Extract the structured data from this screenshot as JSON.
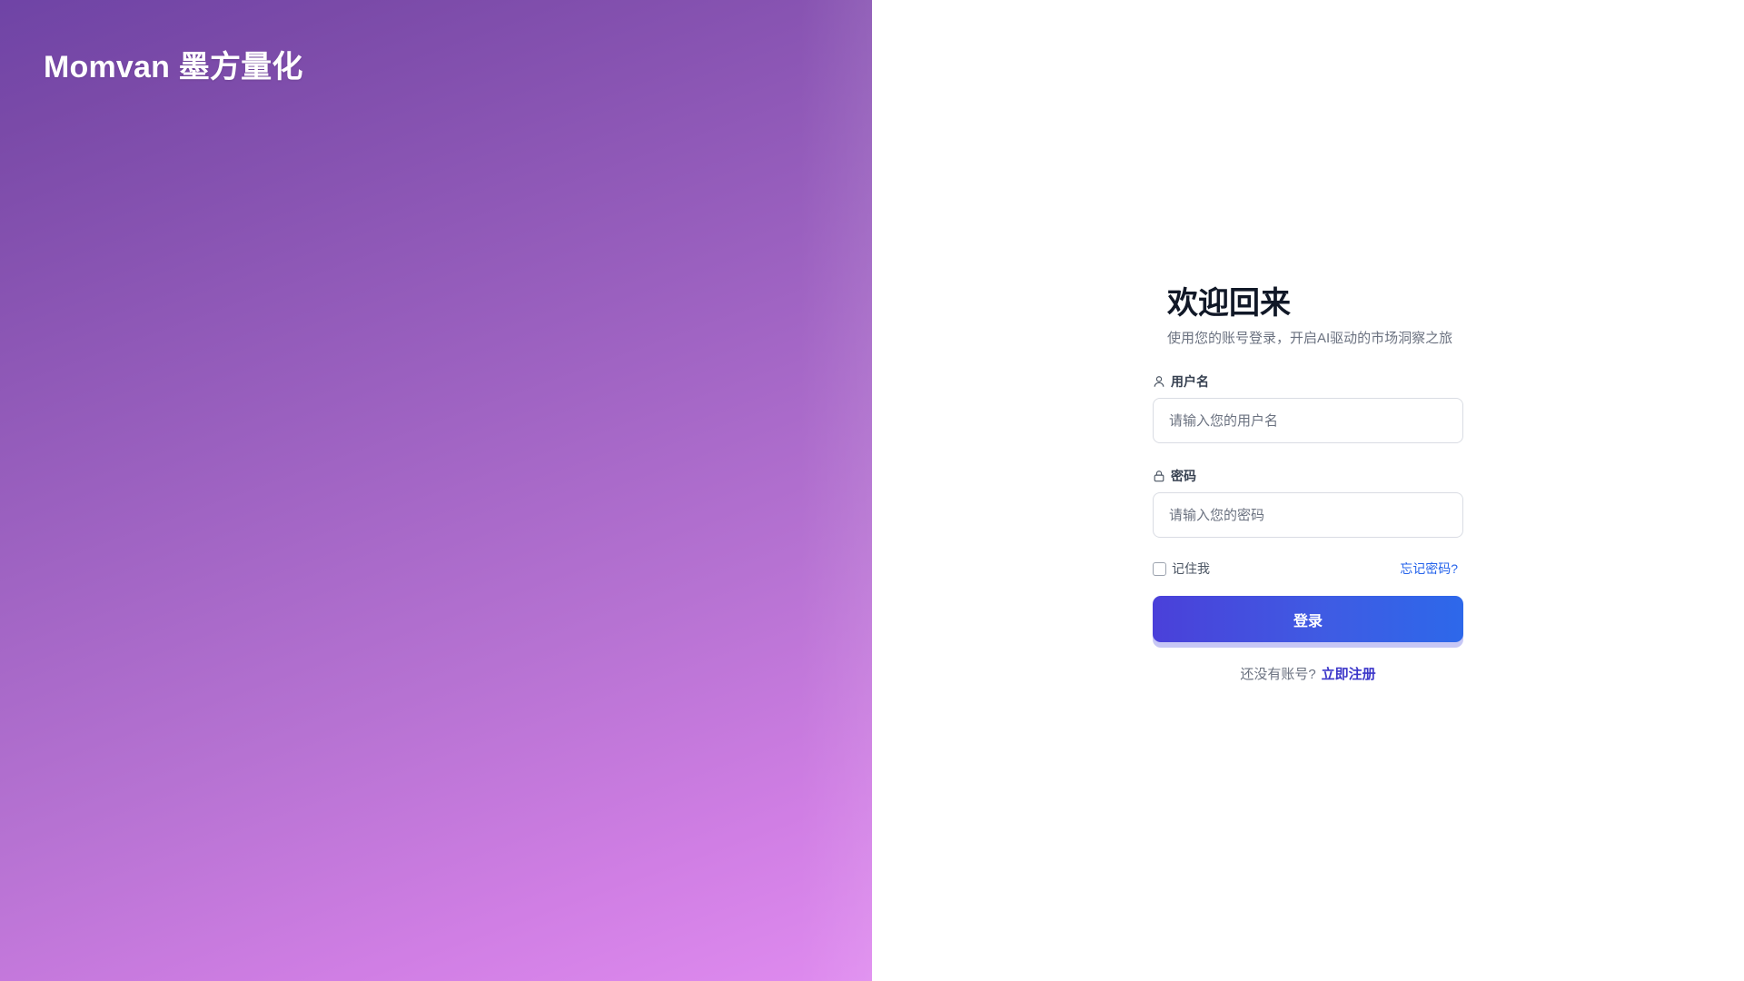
{
  "brand": {
    "name": "Momvan 墨方量化"
  },
  "login": {
    "title": "欢迎回来",
    "subtitle": "使用您的账号登录，开启AI驱动的市场洞察之旅",
    "username": {
      "label": "用户名",
      "placeholder": "请输入您的用户名",
      "icon": "user-icon"
    },
    "password": {
      "label": "密码",
      "placeholder": "请输入您的密码",
      "icon": "lock-icon"
    },
    "remember_label": "记住我",
    "forgot_label": "忘记密码?",
    "submit_label": "登录",
    "signup_prompt": "还没有账号?",
    "signup_link": "立即注册"
  },
  "colors": {
    "accent": "#4a40d9",
    "link": "#2563eb",
    "signup_link": "#3b36c9",
    "gradient_start": "#6f44a6",
    "gradient_end": "#df8bef"
  }
}
